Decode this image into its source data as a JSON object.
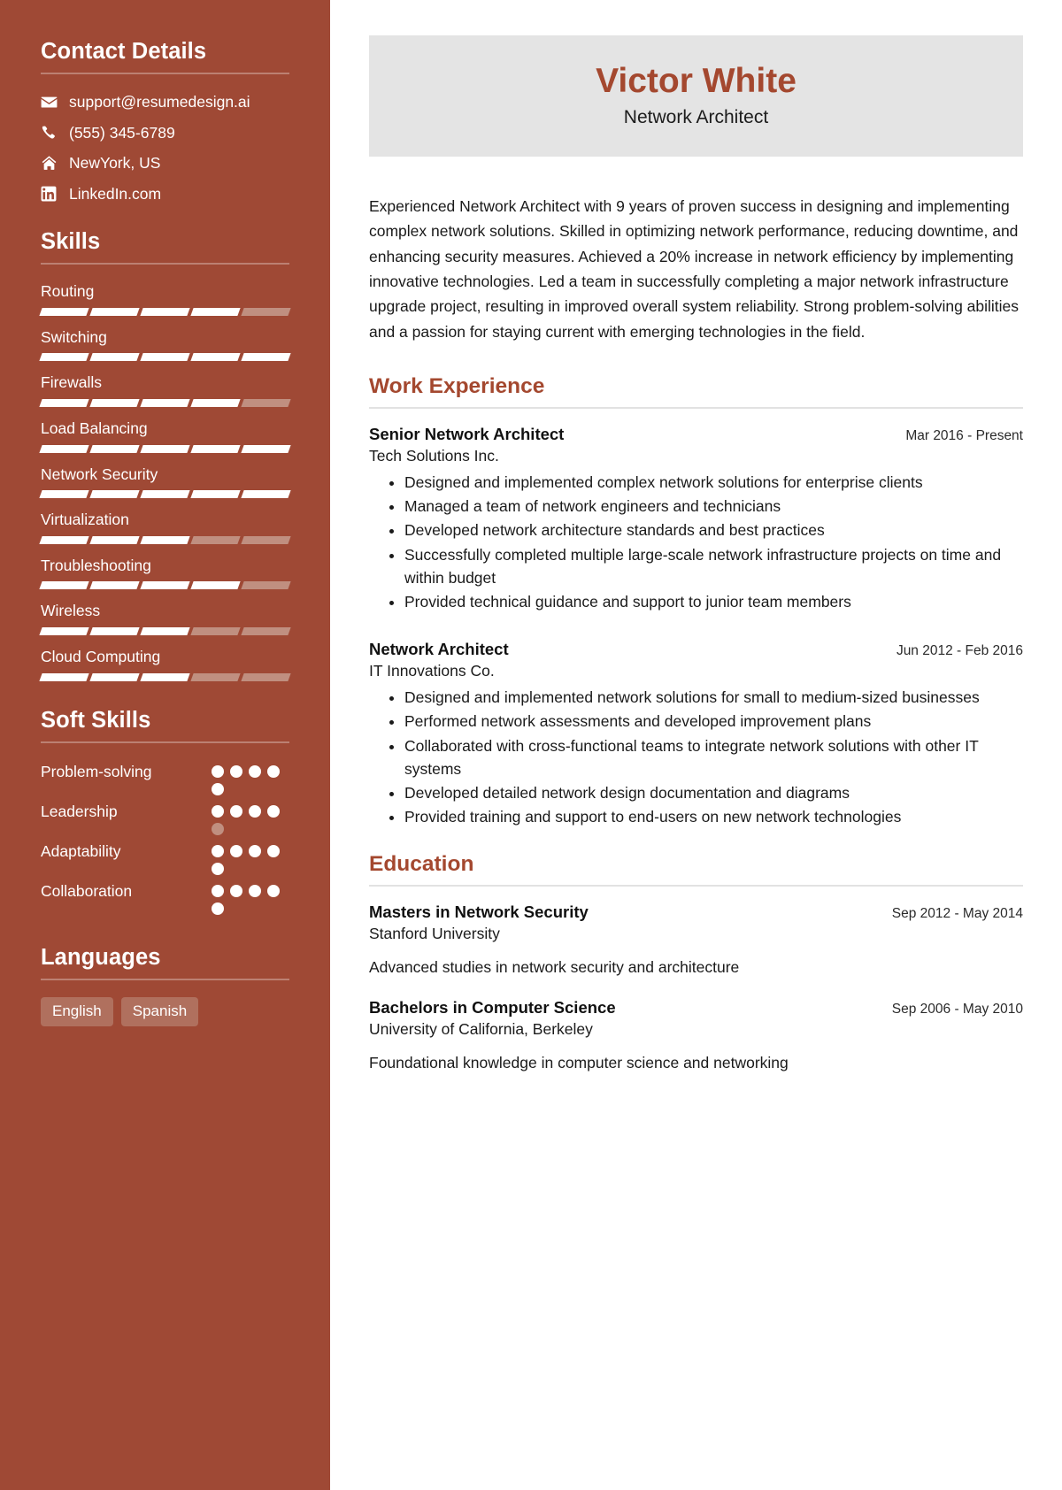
{
  "theme": {
    "sidebar_bg": "#9f4935",
    "accent": "#a4482f",
    "name_card_bg": "#e4e4e4",
    "pill_bg": "#b0705e",
    "bar_on": "#ffffff",
    "bar_off": "#c08f80"
  },
  "sidebar": {
    "contact": {
      "heading": "Contact Details",
      "items": [
        {
          "icon": "envelope-icon",
          "value": "support@resumedesign.ai"
        },
        {
          "icon": "phone-icon",
          "value": "(555) 345-6789"
        },
        {
          "icon": "home-icon",
          "value": "NewYork, US"
        },
        {
          "icon": "linkedin-icon",
          "value": "LinkedIn.com"
        }
      ]
    },
    "skills": {
      "heading": "Skills",
      "max": 5,
      "items": [
        {
          "label": "Routing",
          "level": 4
        },
        {
          "label": "Switching",
          "level": 5
        },
        {
          "label": "Firewalls",
          "level": 4
        },
        {
          "label": "Load Balancing",
          "level": 5
        },
        {
          "label": "Network Security",
          "level": 5
        },
        {
          "label": "Virtualization",
          "level": 3
        },
        {
          "label": "Troubleshooting",
          "level": 4
        },
        {
          "label": "Wireless",
          "level": 3
        },
        {
          "label": "Cloud Computing",
          "level": 3
        }
      ]
    },
    "soft_skills": {
      "heading": "Soft Skills",
      "max": 5,
      "items": [
        {
          "label": "Problem-solving",
          "level": 5
        },
        {
          "label": "Leadership",
          "level": 4
        },
        {
          "label": "Adaptability",
          "level": 5
        },
        {
          "label": "Collaboration",
          "level": 5
        }
      ]
    },
    "languages": {
      "heading": "Languages",
      "items": [
        "English",
        "Spanish"
      ]
    }
  },
  "main": {
    "name": "Victor White",
    "title": "Network Architect",
    "summary": "Experienced Network Architect with 9 years of proven success in designing and implementing complex network solutions. Skilled in optimizing network performance, reducing downtime, and enhancing security measures. Achieved a 20% increase in network efficiency by implementing innovative technologies. Led a team in successfully completing a major network infrastructure upgrade project, resulting in improved overall system reliability. Strong problem-solving abilities and a passion for staying current with emerging technologies in the field.",
    "work": {
      "heading": "Work Experience",
      "entries": [
        {
          "title": "Senior Network Architect",
          "date": "Mar 2016 - Present",
          "org": "Tech Solutions Inc.",
          "bullets": [
            "Designed and implemented complex network solutions for enterprise clients",
            "Managed a team of network engineers and technicians",
            "Developed network architecture standards and best practices",
            "Successfully completed multiple large-scale network infrastructure projects on time and within budget",
            "Provided technical guidance and support to junior team members"
          ]
        },
        {
          "title": "Network Architect",
          "date": "Jun 2012 - Feb 2016",
          "org": "IT Innovations Co.",
          "bullets": [
            "Designed and implemented network solutions for small to medium-sized businesses",
            "Performed network assessments and developed improvement plans",
            "Collaborated with cross-functional teams to integrate network solutions with other IT systems",
            "Developed detailed network design documentation and diagrams",
            "Provided training and support to end-users on new network technologies"
          ]
        }
      ]
    },
    "education": {
      "heading": "Education",
      "entries": [
        {
          "title": "Masters in Network Security",
          "date": "Sep 2012 - May 2014",
          "org": "Stanford University",
          "desc": "Advanced studies in network security and architecture"
        },
        {
          "title": "Bachelors in Computer Science",
          "date": "Sep 2006 - May 2010",
          "org": "University of California, Berkeley",
          "desc": "Foundational knowledge in computer science and networking"
        }
      ]
    }
  }
}
